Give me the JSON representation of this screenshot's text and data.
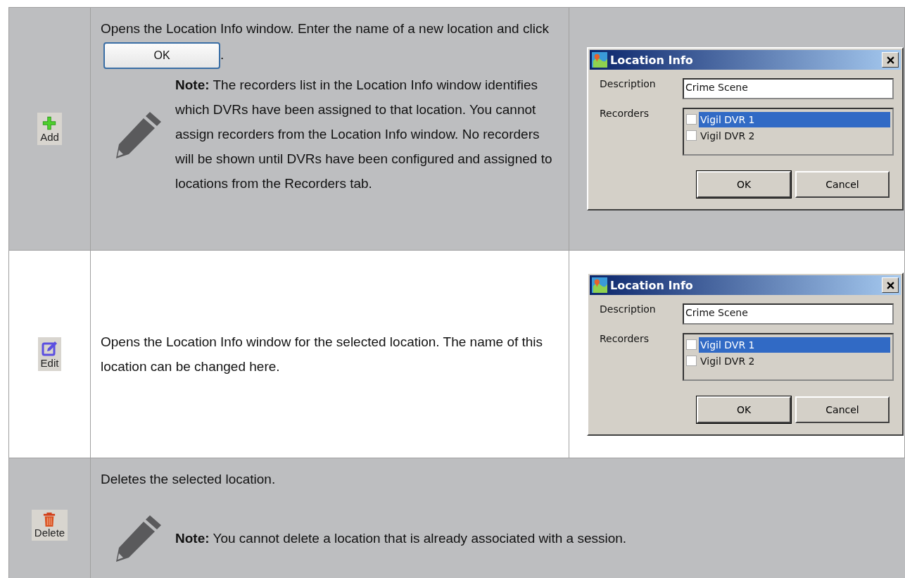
{
  "rows": [
    {
      "icon": {
        "kind": "add",
        "label": "Add"
      },
      "description": {
        "before": "Opens the Location Info window. Enter the name of a new location and click",
        "inline_button": "OK",
        "after": "."
      },
      "note": "**Note:** The recorders list in the Location Info window identifies which DVRs have been assigned to that location. You cannot assign recorders from the Location Info window. No recorders will be shown until DVRs have been configured and assigned to locations from the Recorders tab.",
      "dialog": {
        "title": "Location Info",
        "description_label": "Description",
        "description_value": "Crime Scene",
        "recorders_label": "Recorders",
        "recorders": [
          {
            "label": "Vigil DVR 1",
            "checked": false,
            "selected": true
          },
          {
            "label": "Vigil DVR 2",
            "checked": false,
            "selected": false
          }
        ],
        "buttons": [
          "OK",
          "Cancel"
        ]
      }
    },
    {
      "icon": {
        "kind": "edit",
        "label": "Edit"
      },
      "description": {
        "before": "Opens the Location Info window for the selected location. The name of this location can be changed here."
      },
      "dialog": {
        "title": "Location Info",
        "description_label": "Description",
        "description_value": "Crime Scene",
        "recorders_label": "Recorders",
        "recorders": [
          {
            "label": "Vigil DVR 1",
            "checked": false,
            "selected": true
          },
          {
            "label": "Vigil DVR 2",
            "checked": false,
            "selected": false
          }
        ],
        "buttons": [
          "OK",
          "Cancel"
        ]
      }
    },
    {
      "icon": {
        "kind": "delete",
        "label": "Delete"
      },
      "description": {
        "before": "Deletes the selected location."
      },
      "note": "**Note:** You cannot delete a location that is already associated with a session."
    }
  ]
}
